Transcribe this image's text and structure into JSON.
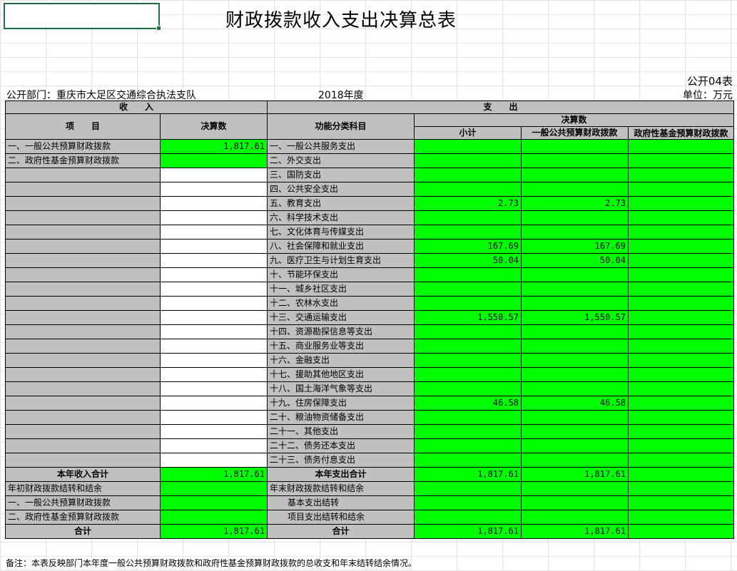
{
  "title": "财政拨款收入支出决算总表",
  "pub_code": "公开04表",
  "dept": "公开部门：重庆市大足区交通综合执法支队",
  "year": "2018年度",
  "unit": "单位：万元",
  "hdr": {
    "income": "收　　入",
    "expense": "支　　出",
    "item": "项　　目",
    "final_amount": "决算数",
    "func_class": "功能分类科目",
    "final_amount2": "决算数",
    "subtotal": "小计",
    "general": "一般公共预算财政拨款",
    "govfund": "政府性基金预算财政拨款"
  },
  "rows": [
    {
      "income_item": "一、一般公共预算财政拨款",
      "income_amount": "1,817.61",
      "func": "一、一般公共服务支出",
      "subtotal": "",
      "general": "",
      "govfund": ""
    },
    {
      "income_item": "二、政府性基金预算财政拨款",
      "income_amount": "",
      "func": "二、外交支出",
      "subtotal": "",
      "general": "",
      "govfund": ""
    },
    {
      "income_item": "",
      "income_amount": "",
      "func": "三、国防支出",
      "subtotal": "",
      "general": "",
      "govfund": ""
    },
    {
      "income_item": "",
      "income_amount": "",
      "func": "四、公共安全支出",
      "subtotal": "",
      "general": "",
      "govfund": ""
    },
    {
      "income_item": "",
      "income_amount": "",
      "func": "五、教育支出",
      "subtotal": "2.73",
      "general": "2.73",
      "govfund": ""
    },
    {
      "income_item": "",
      "income_amount": "",
      "func": "六、科学技术支出",
      "subtotal": "",
      "general": "",
      "govfund": ""
    },
    {
      "income_item": "",
      "income_amount": "",
      "func": "七、文化体育与传媒支出",
      "subtotal": "",
      "general": "",
      "govfund": ""
    },
    {
      "income_item": "",
      "income_amount": "",
      "func": "八、社会保障和就业支出",
      "subtotal": "167.69",
      "general": "167.69",
      "govfund": ""
    },
    {
      "income_item": "",
      "income_amount": "",
      "func": "九、医疗卫生与计划生育支出",
      "subtotal": "50.04",
      "general": "50.04",
      "govfund": ""
    },
    {
      "income_item": "",
      "income_amount": "",
      "func": "十、节能环保支出",
      "subtotal": "",
      "general": "",
      "govfund": ""
    },
    {
      "income_item": "",
      "income_amount": "",
      "func": "十一、城乡社区支出",
      "subtotal": "",
      "general": "",
      "govfund": ""
    },
    {
      "income_item": "",
      "income_amount": "",
      "func": "十二、农林水支出",
      "subtotal": "",
      "general": "",
      "govfund": ""
    },
    {
      "income_item": "",
      "income_amount": "",
      "func": "十三、交通运输支出",
      "subtotal": "1,550.57",
      "general": "1,550.57",
      "govfund": ""
    },
    {
      "income_item": "",
      "income_amount": "",
      "func": "十四、资源勘探信息等支出",
      "subtotal": "",
      "general": "",
      "govfund": ""
    },
    {
      "income_item": "",
      "income_amount": "",
      "func": "十五、商业服务业等支出",
      "subtotal": "",
      "general": "",
      "govfund": ""
    },
    {
      "income_item": "",
      "income_amount": "",
      "func": "十六、金融支出",
      "subtotal": "",
      "general": "",
      "govfund": ""
    },
    {
      "income_item": "",
      "income_amount": "",
      "func": "十七、援助其他地区支出",
      "subtotal": "",
      "general": "",
      "govfund": ""
    },
    {
      "income_item": "",
      "income_amount": "",
      "func": "十八、国土海洋气象等支出",
      "subtotal": "",
      "general": "",
      "govfund": ""
    },
    {
      "income_item": "",
      "income_amount": "",
      "func": "十九、住房保障支出",
      "subtotal": "46.58",
      "general": "46.58",
      "govfund": ""
    },
    {
      "income_item": "",
      "income_amount": "",
      "func": "二十、粮油物资储备支出",
      "subtotal": "",
      "general": "",
      "govfund": ""
    },
    {
      "income_item": "",
      "income_amount": "",
      "func": "二十一、其他支出",
      "subtotal": "",
      "general": "",
      "govfund": ""
    },
    {
      "income_item": "",
      "income_amount": "",
      "func": "二十二、债务还本支出",
      "subtotal": "",
      "general": "",
      "govfund": ""
    },
    {
      "income_item": "",
      "income_amount": "",
      "func": "二十三、债务付息支出",
      "subtotal": "",
      "general": "",
      "govfund": ""
    }
  ],
  "totals": {
    "income_label": "本年收入合计",
    "income_amount": "1,817.61",
    "expense_label": "本年支出合计",
    "subtotal": "1,817.61",
    "general": "1,817.61",
    "govfund": ""
  },
  "carry": [
    {
      "income_item": "年初财政拨款结转和结余",
      "func": "年末财政拨款结转和结余"
    },
    {
      "income_item": "一、一般公共预算财政拨款",
      "func": "基本支出结转"
    },
    {
      "income_item": "二、政府性基金预算财政拨款",
      "func": "项目支出结转和结余"
    }
  ],
  "grand": {
    "income_label": "合计",
    "income_amount": "1,817.61",
    "expense_label": "合计",
    "subtotal": "1,817.61",
    "general": "1,817.61",
    "govfund": ""
  },
  "note": "备注：本表反映部门本年度一般公共预算财政拨款和政府性基金预算财政拨款的总收支和年末结转结余情况。"
}
